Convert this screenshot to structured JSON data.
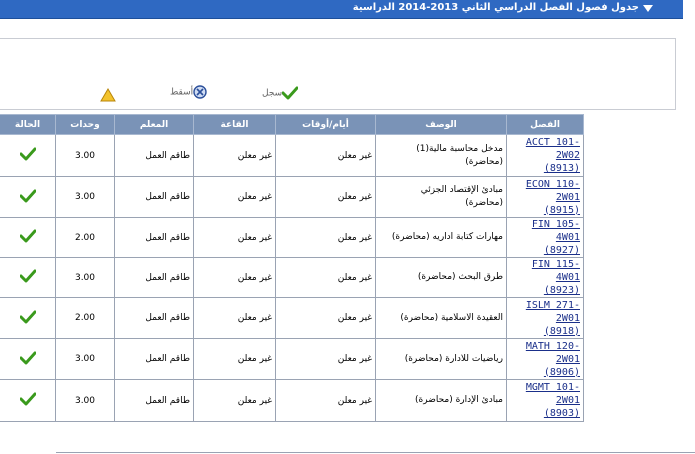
{
  "header": {
    "title": "جدول فصول الفصل الدراسي الثاني 2013-2014 الدراسية"
  },
  "legend": {
    "enrolled": "سجل",
    "dropped": "أسقط"
  },
  "colors": {
    "header_bg": "#2f69c2",
    "table_header_bg": "#7a93b7",
    "check": "#3a9a1c",
    "link": "#1a2f8a"
  },
  "table": {
    "headers": {
      "status": "الحالة",
      "units": "وحدات",
      "instructor": "المعلم",
      "room": "القاعة",
      "days_times": "أيام/أوقات",
      "description": "الوصف",
      "class": "الفصل"
    },
    "rows": [
      {
        "class_l1": "ACCT 101-",
        "class_l2": "2W02",
        "class_l3": "(8913)",
        "desc_l1": "مدخل محاسبة مالية(1)",
        "desc_l2": "(محاضرة)",
        "days": "غير معلن",
        "room": "غير معلن",
        "instructor": "طاقم العمل",
        "units": "3.00"
      },
      {
        "class_l1": "ECON 110-",
        "class_l2": "2W01",
        "class_l3": "(8915)",
        "desc_l1": "مبادئ الإقتصاد الجزئي",
        "desc_l2": "(محاضرة)",
        "days": "غير معلن",
        "room": "غير معلن",
        "instructor": "طاقم العمل",
        "units": "3.00"
      },
      {
        "class_l1": "FIN 105-4W01",
        "class_l2": "",
        "class_l3": "(8927)",
        "desc_l1": "مهارات كتابة اداريه (محاضرة)",
        "desc_l2": "",
        "days": "غير معلن",
        "room": "غير معلن",
        "instructor": "طاقم العمل",
        "units": "2.00"
      },
      {
        "class_l1": "FIN 115-4W01",
        "class_l2": "",
        "class_l3": "(8923)",
        "desc_l1": "طرق البحث (محاضرة)",
        "desc_l2": "",
        "days": "غير معلن",
        "room": "غير معلن",
        "instructor": "طاقم العمل",
        "units": "3.00"
      },
      {
        "class_l1": "ISLM 271-",
        "class_l2": "2W01",
        "class_l3": "(8918)",
        "desc_l1": "العقيدة الاسلامية (محاضرة)",
        "desc_l2": "",
        "days": "غير معلن",
        "room": "غير معلن",
        "instructor": "طاقم العمل",
        "units": "2.00"
      },
      {
        "class_l1": "MATH 120-",
        "class_l2": "2W01",
        "class_l3": "(8906)",
        "desc_l1": "رياضيات للادارة (محاضرة)",
        "desc_l2": "",
        "days": "غير معلن",
        "room": "غير معلن",
        "instructor": "طاقم العمل",
        "units": "3.00"
      },
      {
        "class_l1": "MGMT 101-",
        "class_l2": "2W01",
        "class_l3": "(8903)",
        "desc_l1": "مبادئ الإدارة (محاضرة)",
        "desc_l2": "",
        "days": "غير معلن",
        "room": "غير معلن",
        "instructor": "طاقم العمل",
        "units": "3.00"
      }
    ]
  }
}
